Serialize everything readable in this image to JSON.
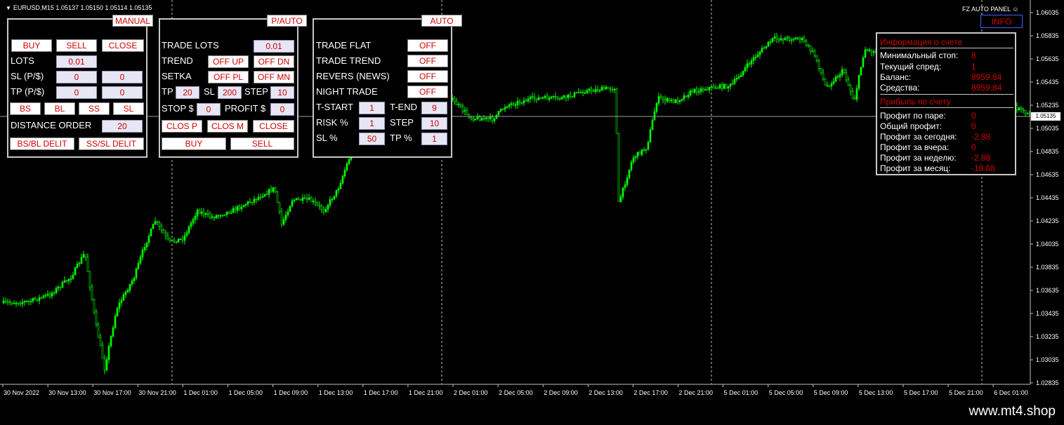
{
  "chart": {
    "symbol_line": "EURUSD,M15  1.05137 1.05150 1.05114 1.05135",
    "current_price": "1.05135",
    "panel_title": "FZ AUTO PANEL",
    "price_axis": [
      "1.06035",
      "1.05835",
      "1.05635",
      "1.05435",
      "1.05235",
      "1.05035",
      "1.04835",
      "1.04635",
      "1.04435",
      "1.04235",
      "1.04035",
      "1.03835",
      "1.03635",
      "1.03435",
      "1.03235",
      "1.03035",
      "1.02835"
    ],
    "time_axis": [
      "30 Nov 2022",
      "30 Nov 13:00",
      "30 Nov 17:00",
      "30 Nov 21:00",
      "1 Dec 01:00",
      "1 Dec 05:00",
      "1 Dec 09:00",
      "1 Dec 13:00",
      "1 Dec 17:00",
      "1 Dec 21:00",
      "2 Dec 01:00",
      "2 Dec 05:00",
      "2 Dec 09:00",
      "2 Dec 13:00",
      "2 Dec 17:00",
      "2 Dec 21:00",
      "5 Dec 01:00",
      "5 Dec 05:00",
      "5 Dec 09:00",
      "5 Dec 13:00",
      "5 Dec 17:00",
      "5 Dec 21:00",
      "6 Dec 01:00"
    ],
    "colors": {
      "bull": "#00ff00",
      "bear": "#00ff00",
      "grid": "#c0c0c0",
      "bg": "#000000"
    }
  },
  "manual": {
    "tab": "MANUAL",
    "buy": "BUY",
    "sell": "SELL",
    "close": "CLOSE",
    "lots_label": "LOTS",
    "lots_value": "0.01",
    "sl_label": "SL  (P/$)",
    "sl_p": "0",
    "sl_usd": "0",
    "tp_label": "TP  (P/$)",
    "tp_p": "0",
    "tp_usd": "0",
    "bs": "BS",
    "bl": "BL",
    "ss": "SS",
    "sl_btn": "SL",
    "distance_label": "DISTANCE ORDER",
    "distance_value": "20",
    "bsbl_delit": "BS/BL DELIT",
    "sssl_delit": "SS/SL DELIT"
  },
  "pauto": {
    "tab": "P/AUTO",
    "trade_lots_label": "TRADE LOTS",
    "trade_lots_value": "0.01",
    "trend_label": "TREND",
    "off_up": "OFF UP",
    "off_dn": "OFF DN",
    "setka_label": "SETKA",
    "off_pl": "OFF PL",
    "off_mn": "OFF MN",
    "tp_label": "TP",
    "tp_value": "20",
    "sl_label": "SL",
    "sl_value": "200",
    "step_label": "STEP",
    "step_value": "10",
    "stop_label": "STOP $",
    "stop_value": "0",
    "profit_label": "PROFIT $",
    "profit_value": "0",
    "clos_p": "CLOS P",
    "clos_m": "CLOS M",
    "close": "CLOSE",
    "buy": "BUY",
    "sell": "SELL"
  },
  "auto": {
    "tab": "AUTO",
    "trade_flat_label": "TRADE FLAT",
    "trade_flat_value": "OFF",
    "trade_trend_label": "TRADE TREND",
    "trade_trend_value": "OFF",
    "revers_label": "REVERS (NEWS)",
    "revers_value": "OFF",
    "night_label": "NIGHT TRADE",
    "night_value": "OFF",
    "tstart_label": "T-START",
    "tstart_value": "1",
    "tend_label": "T-END",
    "tend_value": "9",
    "risk_label": "RISK  %",
    "risk_value": "1",
    "step_label": "STEP",
    "step_value": "10",
    "sl_label": "SL  %",
    "sl_value": "50",
    "tp_label": "TP  %",
    "tp_value": "1"
  },
  "info": {
    "tab": "INFO",
    "account_header": "Информация о счете",
    "min_stop_label": "Минимальный стоп:",
    "min_stop_value": "8",
    "spread_label": "Текущий спред:",
    "spread_value": "1",
    "balance_label": "Баланс:",
    "balance_value": "8959.84",
    "equity_label": "Средства:",
    "equity_value": "8959.84",
    "profit_header": "Прибыль по счету",
    "pair_label": "Профит по паре:",
    "pair_value": "0",
    "total_label": "Общий профит:",
    "total_value": "0",
    "today_label": "Профит за сегодня:",
    "today_value": "-2.88",
    "yesterday_label": "Профит за вчера:",
    "yesterday_value": "0",
    "week_label": "Профит за неделю:",
    "week_value": "-2.88",
    "month_label": "Профит за месяц:",
    "month_value": "-18.88"
  },
  "watermark": "www.mt4.shop"
}
